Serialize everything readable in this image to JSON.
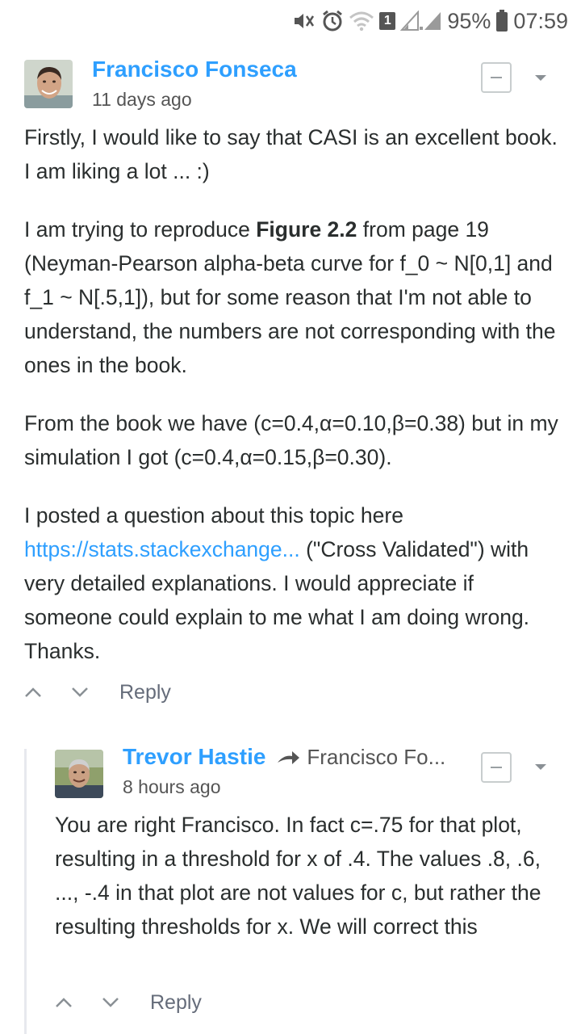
{
  "status_bar": {
    "battery": "95%",
    "time": "07:59",
    "sim_number": "1",
    "icons": [
      "mute-icon",
      "alarm-icon",
      "wifi-icon",
      "sim-icon",
      "signal-icon",
      "battery-icon"
    ]
  },
  "comments": [
    {
      "author": "Francisco Fonseca",
      "timestamp": "11 days ago",
      "paragraphs": {
        "p1": "Firstly, I would like to say that CASI is an excellent book. I am liking a lot ... :)",
        "p2_pre": "I am trying to reproduce ",
        "p2_bold": "Figure 2.2",
        "p2_post": " from page 19 (Neyman-Pearson alpha-beta curve for f_0 ~ N[0,1] and f_1 ~ N[.5,1]), but for some reason that I'm not able to understand, the numbers are not corresponding with the ones in the book.",
        "p3": "From the book we have (c=0.4,α=0.10,β=0.38) but in my simulation I got (c=0.4,α=0.15,β=0.30).",
        "p4_pre": "I posted a question about this topic here ",
        "p4_link": "https://stats.stackexchange...",
        "p4_post": " (\"Cross Validated\") with very detailed explanations. I would appreciate if someone could explain to me what I am doing wrong. Thanks."
      },
      "reply_label": "Reply"
    },
    {
      "author": "Trevor Hastie",
      "reply_to": "Francisco Fo...",
      "timestamp": "8 hours ago",
      "text": "You are right Francisco. In fact c=.75 for that plot, resulting in a threshold for x of .4. The values .8, .6, ..., -.4 in that plot are not values for c, but rather the resulting thresholds for x. We will correct this",
      "reply_label": "Reply"
    }
  ],
  "colors": {
    "accent": "#2e9fff",
    "text": "#2a2e2e",
    "muted": "#656c7a"
  }
}
